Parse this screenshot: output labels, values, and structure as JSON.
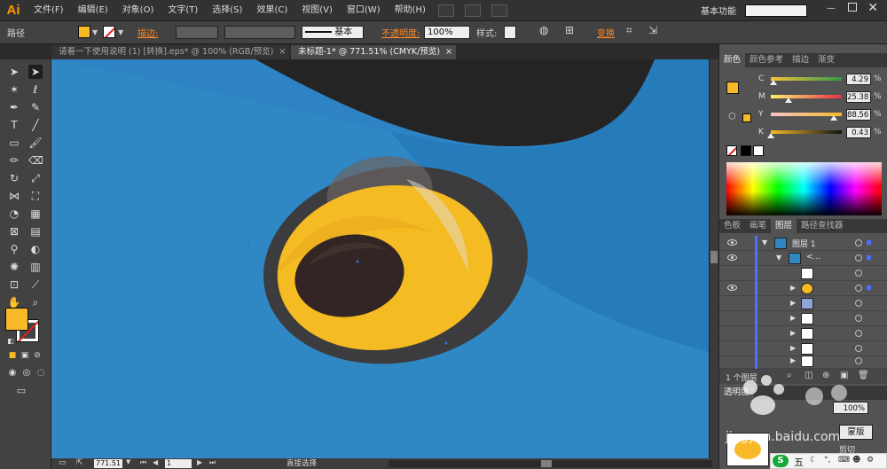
{
  "app": {
    "logo": "Ai"
  },
  "menu": [
    "文件(F)",
    "编辑(E)",
    "对象(O)",
    "文字(T)",
    "选择(S)",
    "效果(C)",
    "视图(V)",
    "窗口(W)",
    "帮助(H)"
  ],
  "workspace_label": "基本功能",
  "control": {
    "object_type": "路径",
    "stroke_label": "描边:",
    "stroke_profile": "基本",
    "opacity_label": "不透明度:",
    "opacity_value": "100%",
    "style_label": "样式:",
    "transform_label": "变换"
  },
  "tabs": [
    {
      "label": "请看一下使用说明 (1) [转换].eps* @ 100% (RGB/预览)",
      "close": "×"
    },
    {
      "label": "未标题-1* @ 771.51% (CMYK/预览)",
      "close": "×"
    }
  ],
  "status": {
    "zoom": "771.51",
    "page": "1",
    "tool": "直接选择"
  },
  "color_panel": {
    "tabs": [
      "颜色",
      "颜色参考",
      "描边",
      "渐变"
    ],
    "sliders": [
      {
        "label": "C",
        "value": "4.29",
        "fraction": 0.0429,
        "unit": "%"
      },
      {
        "label": "M",
        "value": "25.38",
        "fraction": 0.2538,
        "unit": "%"
      },
      {
        "label": "Y",
        "value": "88.56",
        "fraction": 0.8856,
        "unit": "%"
      },
      {
        "label": "K",
        "value": "0.43",
        "fraction": 0.0043,
        "unit": "%"
      }
    ],
    "colors": {
      "fill": "#f7b928"
    }
  },
  "layers_panel": {
    "tabs": [
      "色板",
      "画笔",
      "图层",
      "路径查找器"
    ],
    "layer_name": "图层 1",
    "group_name": "<...",
    "count": "1 个图层"
  },
  "transparency_panel": {
    "tab": "透明度",
    "value": "100%",
    "mask_button": "蒙版",
    "clip_label": "剪切"
  },
  "watermark": "jingyan.baidu.com",
  "ime": {
    "badge": "S",
    "text": "五"
  },
  "art_colors": {
    "background": "#2f87c4",
    "dark": "#242424",
    "eye_ring": "#3c3b3d",
    "iris": "#f5bb23",
    "pupil": "#332523"
  }
}
